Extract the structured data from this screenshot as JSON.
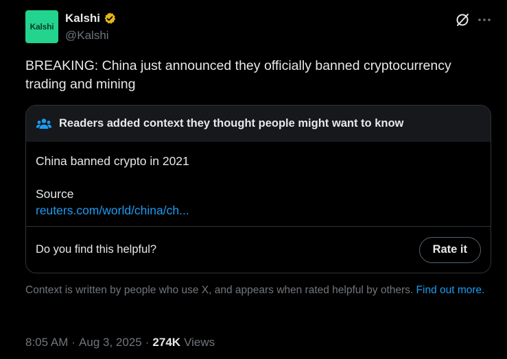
{
  "author": {
    "avatar_text": "Kalshi",
    "name": "Kalshi",
    "handle": "@Kalshi",
    "verified_color": "#e2b719"
  },
  "tweet": {
    "text": "BREAKING: China just announced they officially banned cryptocurrency trading and mining"
  },
  "community_note": {
    "header": "Readers added context they thought people might want to know",
    "claim": "China banned crypto in 2021",
    "source_label": "Source",
    "source_link": "reuters.com/world/china/ch...",
    "helpful_question": "Do you find this helpful?",
    "rate_button": "Rate it",
    "footer_text": "Context is written by people who use X, and appears when rated helpful by others.",
    "find_out_more": "Find out more."
  },
  "meta": {
    "time": "8:05 AM",
    "sep1": "·",
    "date": "Aug 3, 2025",
    "sep2": "·",
    "views_count": "274K",
    "views_label": "Views"
  },
  "colors": {
    "background": "#000000",
    "text": "#e7e9ea",
    "muted": "#71767b",
    "link": "#1d9bf0",
    "avatar_bg": "#22d48e"
  },
  "icons": {
    "verified": "verified-badge-icon",
    "grok": "grok-icon",
    "more": "more-icon",
    "people": "people-icon"
  }
}
